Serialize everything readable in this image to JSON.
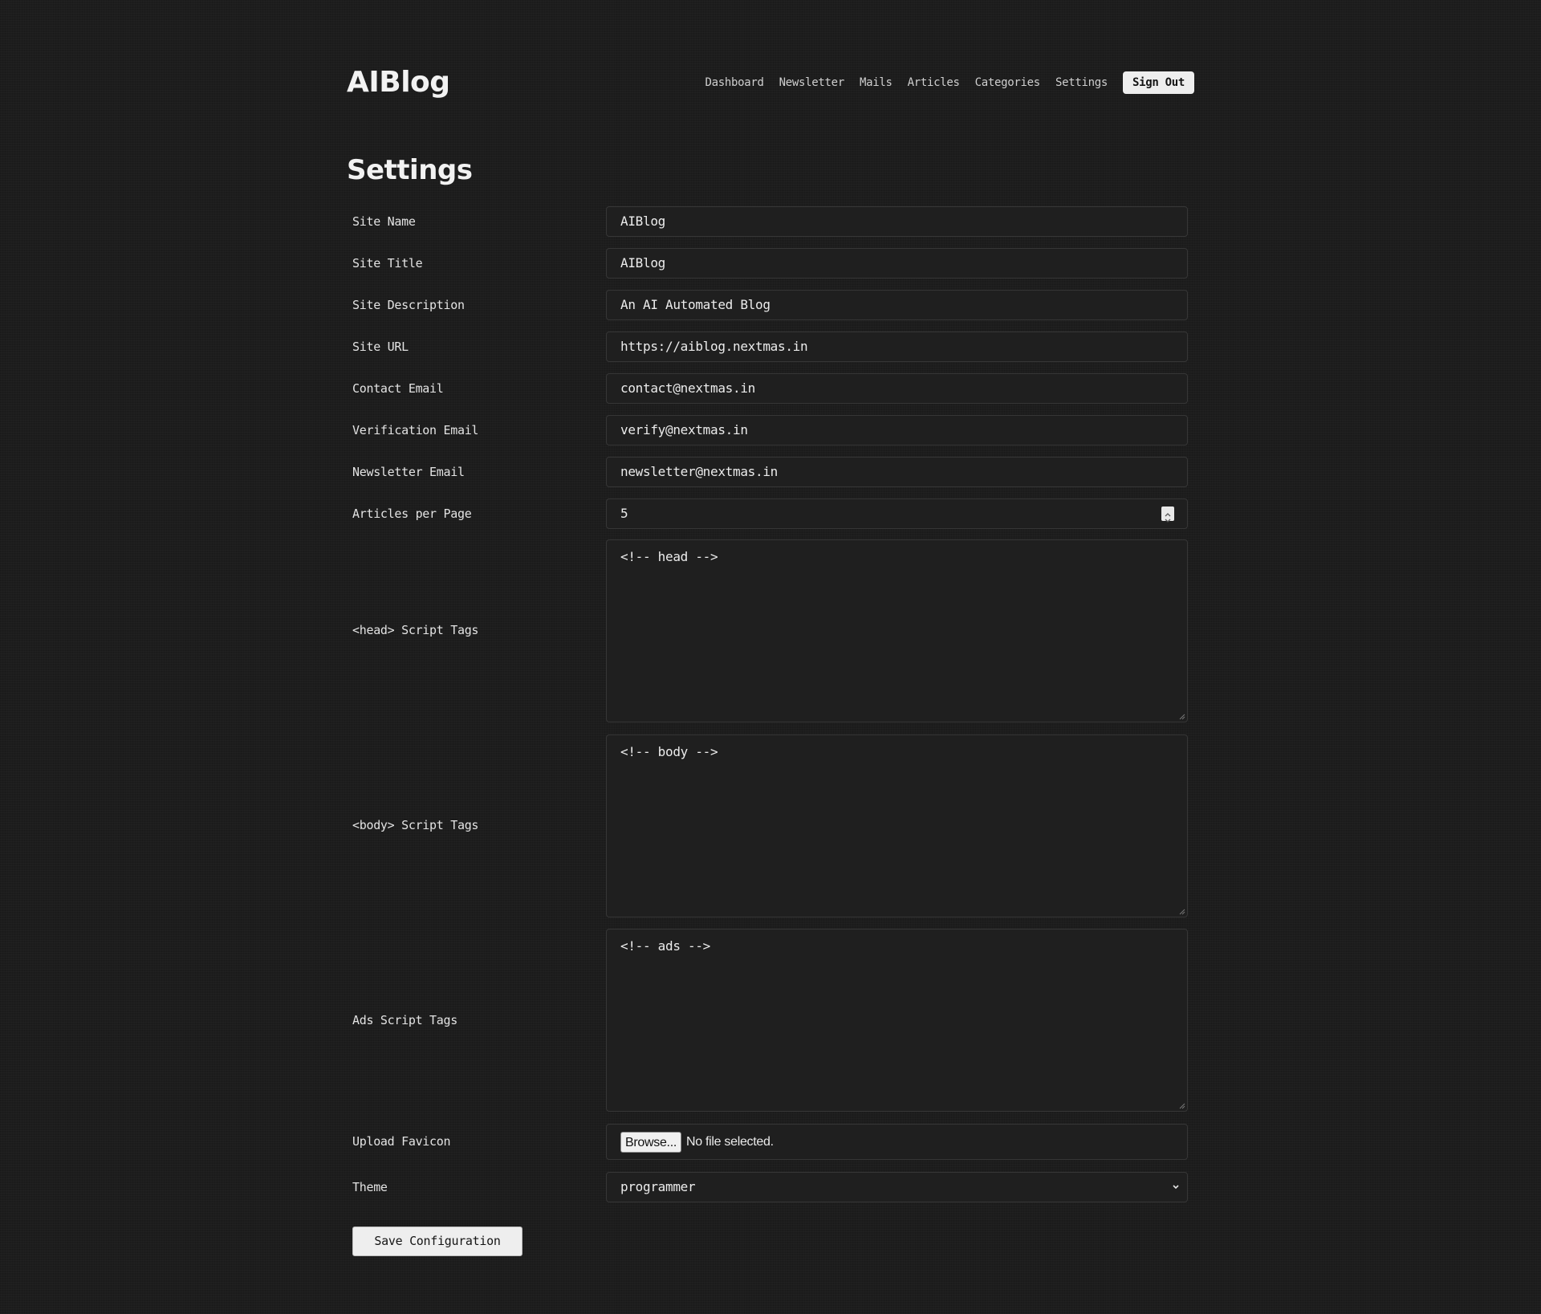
{
  "header": {
    "logo": "AIBlog",
    "nav": [
      "Dashboard",
      "Newsletter",
      "Mails",
      "Articles",
      "Categories",
      "Settings"
    ],
    "sign_out": "Sign Out"
  },
  "page": {
    "title": "Settings"
  },
  "form": {
    "site_name": {
      "label": "Site Name",
      "value": "AIBlog"
    },
    "site_title": {
      "label": "Site Title",
      "value": "AIBlog"
    },
    "site_description": {
      "label": "Site Description",
      "value": "An AI Automated Blog"
    },
    "site_url": {
      "label": "Site URL",
      "value": "https://aiblog.nextmas.in"
    },
    "contact_email": {
      "label": "Contact Email",
      "value": "contact@nextmas.in"
    },
    "verification_email": {
      "label": "Verification Email",
      "value": "verify@nextmas.in"
    },
    "newsletter_email": {
      "label": "Newsletter Email",
      "value": "newsletter@nextmas.in"
    },
    "articles_per_page": {
      "label": "Articles per Page",
      "value": "5"
    },
    "head_scripts": {
      "label": "<head> Script Tags",
      "value": "<!-- head -->"
    },
    "body_scripts": {
      "label": "<body> Script Tags",
      "value": "<!-- body -->"
    },
    "ads_scripts": {
      "label": "Ads Script Tags",
      "value": "<!-- ads -->"
    },
    "favicon": {
      "label": "Upload Favicon",
      "browse": "Browse...",
      "status": "No file selected."
    },
    "theme": {
      "label": "Theme",
      "value": "programmer"
    },
    "save": "Save Configuration"
  },
  "colors": {
    "background": "#1d1d1d",
    "field_background": "#1f1f1f",
    "field_border": "#363636",
    "button": "#eeeeee",
    "text": "#e6e6e6"
  }
}
